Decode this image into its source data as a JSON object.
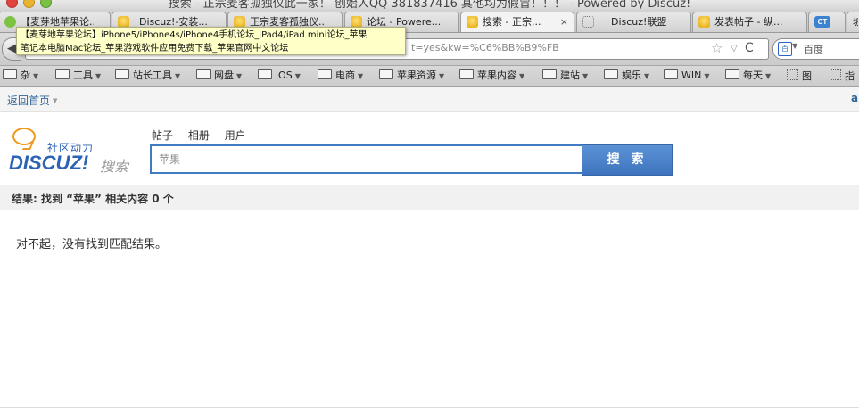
{
  "window": {
    "title": "搜索 - 正宗麦客孤独仪此一家！ 创始人QQ 381837416 其他均为假冒！！！ - Powered by Discuz!"
  },
  "tabs": [
    {
      "label": "【麦芽地苹果论...",
      "favicon": "apple-bubble"
    },
    {
      "label": "Discuz!-安装...",
      "favicon": "bubble"
    },
    {
      "label": "正宗麦客孤独仪...",
      "favicon": "bubble"
    },
    {
      "label": "论坛 - Powere...",
      "favicon": "bubble"
    },
    {
      "label": "搜索 - 正宗...",
      "favicon": "bubble",
      "active": true,
      "close": "×"
    },
    {
      "label": "Discuz!联盟",
      "favicon": "dotted-box"
    },
    {
      "label": "发表帖子 - 纵...",
      "favicon": "bubble"
    },
    {
      "label": "",
      "favicon": "CT"
    },
    {
      "label": "坡",
      "favicon": ""
    }
  ],
  "navbar": {
    "back": "◀",
    "url_visible": "t=yes&kw=%C6%BB%B9%FB",
    "star": "☆",
    "dropdown": "▽",
    "reload": "C",
    "search_engine_badge": "百",
    "search_placeholder": "百度"
  },
  "tooltip": {
    "line1": "【麦芽地苹果论坛】iPhone5/iPhone4s/iPhone4手机论坛_iPad4/iPad mini论坛_苹果",
    "line2": "笔记本电脑Mac论坛_苹果游戏软件应用免费下载_苹果官网中文论坛"
  },
  "bookmarks": [
    {
      "label": "杂",
      "caret": "▼"
    },
    {
      "label": "工具",
      "caret": "▼"
    },
    {
      "label": "站长工具",
      "caret": "▼"
    },
    {
      "label": "网盘",
      "caret": "▼"
    },
    {
      "label": "iOS",
      "caret": "▼"
    },
    {
      "label": "电商",
      "caret": "▼"
    },
    {
      "label": "苹果资源",
      "caret": "▼"
    },
    {
      "label": "苹果内容",
      "caret": "▼"
    },
    {
      "label": "建站",
      "caret": "▼"
    },
    {
      "label": "娱乐",
      "caret": "▼"
    },
    {
      "label": "WIN",
      "caret": "▼"
    },
    {
      "label": "每天",
      "caret": "▼"
    },
    {
      "label": "图",
      "caret": ""
    },
    {
      "label": "指",
      "caret": ""
    }
  ],
  "subheader": {
    "home_link": "返回首页",
    "right_text": "a"
  },
  "logo": {
    "subtitle": "社区动力",
    "brand": "DISCUZ!",
    "search_word": "搜索"
  },
  "search": {
    "tabs": [
      "帖子",
      "相册",
      "用户"
    ],
    "query": "苹果",
    "button": "搜 索"
  },
  "result": {
    "summary": "结果: 找到 “苹果” 相关内容 0 个",
    "empty_message": "对不起，没有找到匹配结果。"
  }
}
